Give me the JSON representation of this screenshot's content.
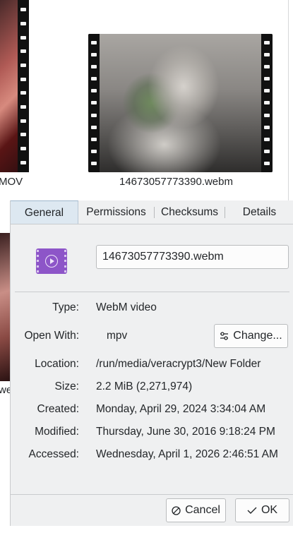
{
  "background": {
    "left_thumb_label": "MOV",
    "right_thumb_label": "14673057773390.webm",
    "lower_left_label": "we"
  },
  "dialog": {
    "tabs": [
      "General",
      "Permissions",
      "Checksums",
      "Details"
    ],
    "active_tab": "General",
    "file_icon": "video-file-icon",
    "filename": "14673057773390.webm",
    "type_label": "Type:",
    "type_value": "WebM video",
    "openwith_label": "Open With:",
    "openwith_value": "mpv",
    "change_button": "Change...",
    "location_label": "Location:",
    "location_value": "/run/media/veracrypt3/New Folder",
    "size_label": "Size:",
    "size_value": "2.2 MiB (2,271,974)",
    "created_label": "Created:",
    "created_value": "Monday, April 29, 2024 3:34:04 AM",
    "modified_label": "Modified:",
    "modified_value": "Thursday, June 30, 2016 9:18:24 PM",
    "accessed_label": "Accessed:",
    "accessed_value": "Wednesday, April 1, 2026 2:46:51 AM",
    "cancel_button": "Cancel",
    "ok_button": "OK"
  },
  "colors": {
    "dialog_bg": "#eff0f1",
    "active_tab_bg": "#dde8f1",
    "video_icon": "#8d55c8"
  }
}
